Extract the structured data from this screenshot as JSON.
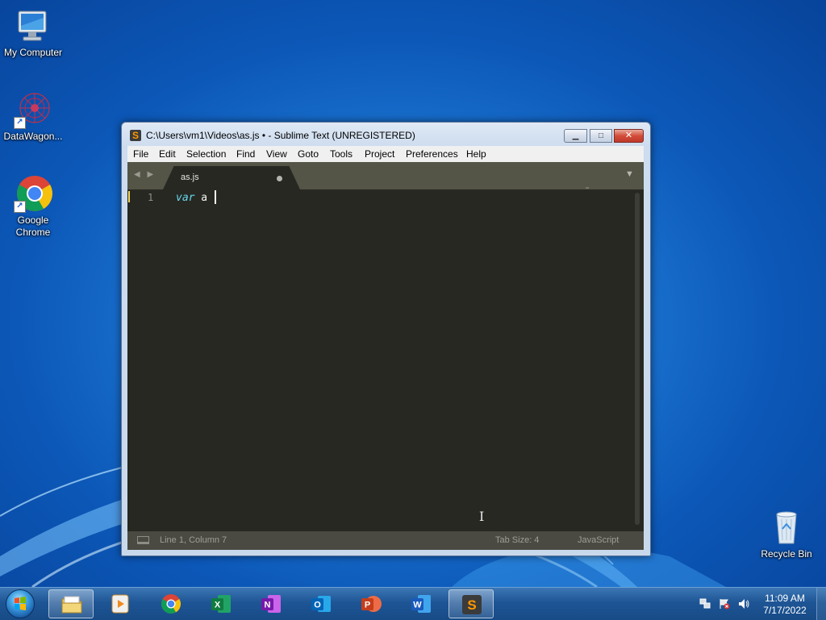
{
  "desktop": {
    "icons": [
      {
        "label": "My Computer"
      },
      {
        "label": "DataWagon..."
      },
      {
        "label": "Google Chrome"
      },
      {
        "label": "Recycle Bin"
      }
    ]
  },
  "window": {
    "title": "C:\\Users\\vm1\\Videos\\as.js • - Sublime Text (UNREGISTERED)",
    "app_glyph": "S",
    "controls": {
      "minimize": "▁",
      "maximize": "□",
      "close": "✕"
    }
  },
  "menu": {
    "items": [
      "File",
      "Edit",
      "Selection",
      "Find",
      "View",
      "Goto",
      "Tools",
      "Project",
      "Preferences",
      "Help"
    ]
  },
  "tabs": {
    "nav": "◀ ▶",
    "active_tab": "as.js",
    "dropdown": "▼"
  },
  "editor": {
    "line_number": "1",
    "keyword": "var",
    "text": " a "
  },
  "status": {
    "position": "Line 1, Column 7",
    "tab_size": "Tab Size: 4",
    "syntax": "JavaScript"
  },
  "taskbar": {
    "apps": [
      "file-explorer",
      "media-player",
      "google-chrome",
      "excel",
      "onenote",
      "outlook",
      "powerpoint",
      "word",
      "sublime-text"
    ],
    "active_app": "sublime-text",
    "clock_time": "11:09 AM",
    "clock_date": "7/17/2022"
  },
  "colors": {
    "editor_bg": "#272822",
    "keyword": "#66d9ef",
    "tab_bar": "#545447",
    "status_bar": "#4a4a42",
    "sublime_accent": "#ff9800"
  }
}
